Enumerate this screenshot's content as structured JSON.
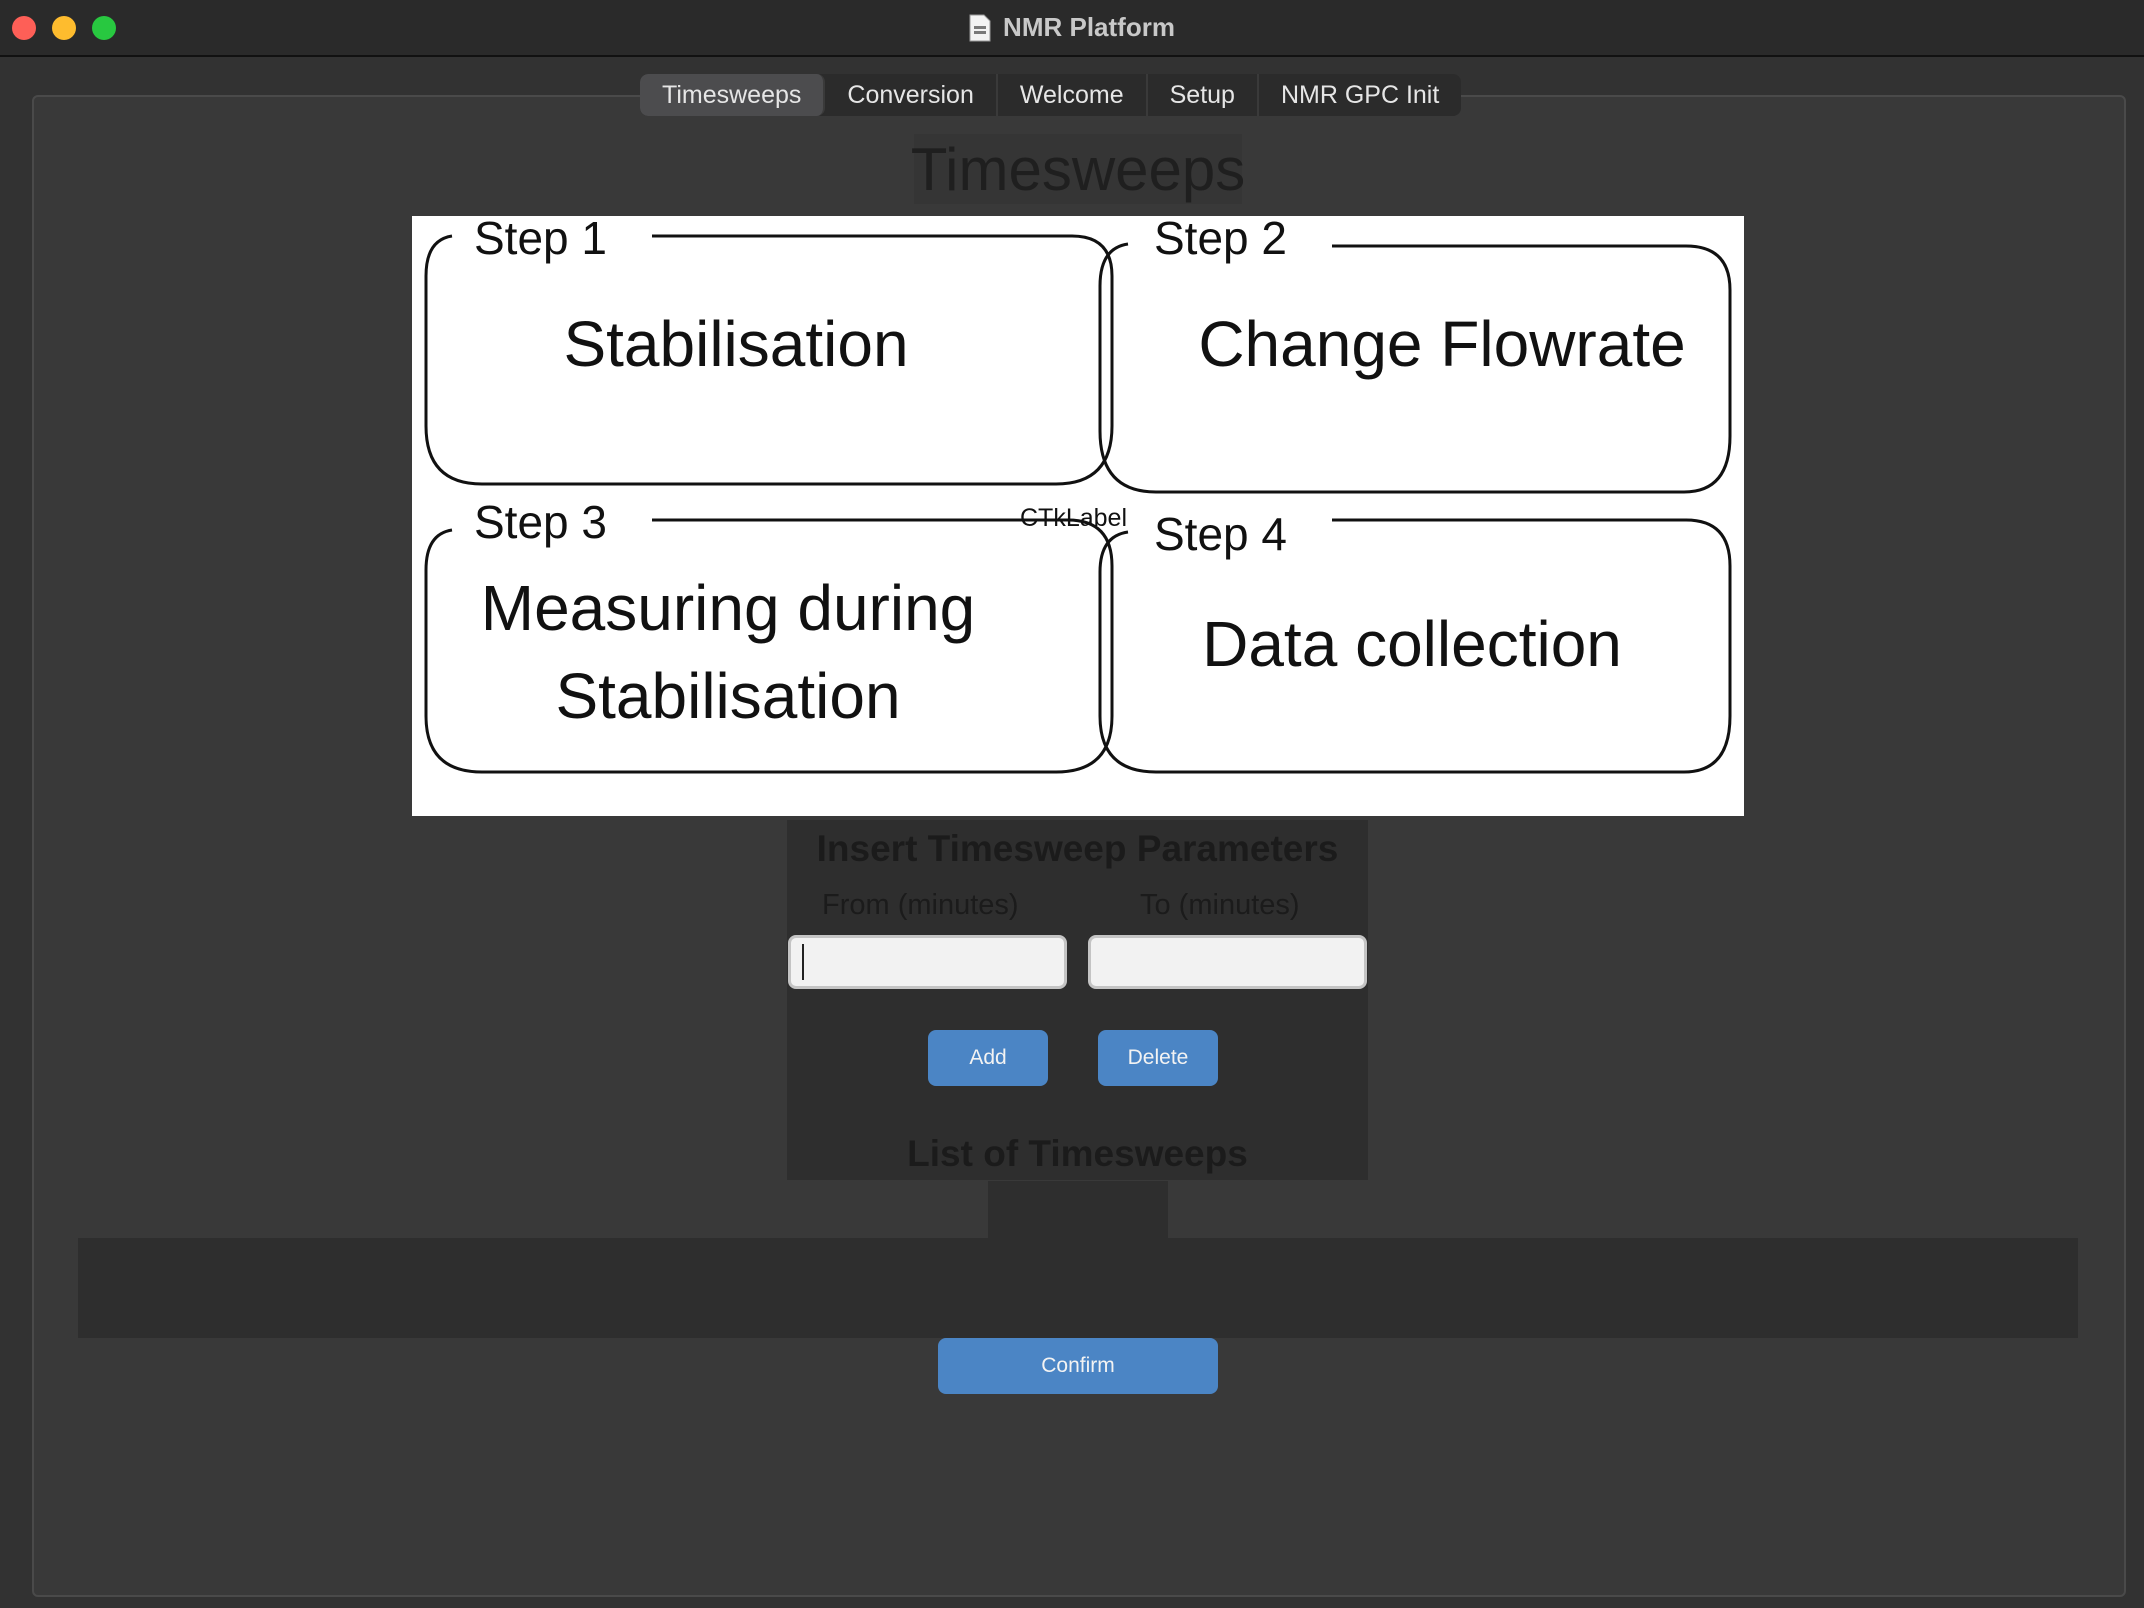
{
  "window": {
    "title": "NMR Platform"
  },
  "tabs": [
    {
      "label": "Timesweeps",
      "active": true
    },
    {
      "label": "Conversion",
      "active": false
    },
    {
      "label": "Welcome",
      "active": false
    },
    {
      "label": "Setup",
      "active": false
    },
    {
      "label": "NMR GPC Init",
      "active": false
    }
  ],
  "page": {
    "title": "Timesweeps"
  },
  "diagram": {
    "label": "CTkLabel",
    "steps": [
      {
        "step": "Step 1",
        "name": "Stabilisation"
      },
      {
        "step": "Step 2",
        "name": "Change Flowrate"
      },
      {
        "step": "Step 3",
        "name_line1": "Measuring during",
        "name_line2": "Stabilisation"
      },
      {
        "step": "Step 4",
        "name": "Data collection"
      }
    ]
  },
  "params": {
    "title": "Insert Timesweep Parameters",
    "from_label": "From (minutes)",
    "to_label": "To (minutes)",
    "from_value": "",
    "to_value": "",
    "add_label": "Add",
    "delete_label": "Delete"
  },
  "list": {
    "title": "List of Timesweeps",
    "items": []
  },
  "confirm_label": "Confirm",
  "colors": {
    "button": "#4b85c5",
    "background": "#393939",
    "tab_active": "#4c4c4e"
  }
}
